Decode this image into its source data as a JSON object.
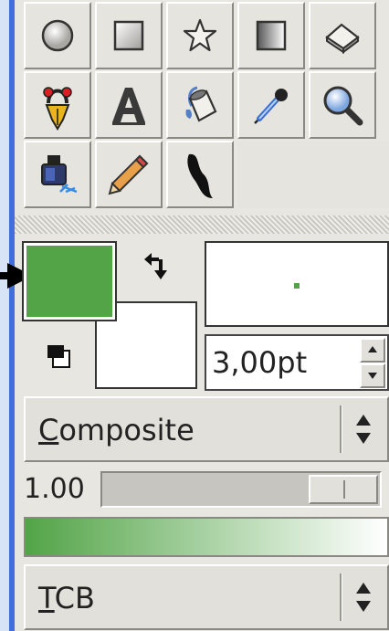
{
  "colors": {
    "foreground": "#52a447",
    "background": "#ffffff",
    "gradient_start": "#52a447",
    "gradient_end": "#ffffff",
    "panel_accent": "#3f6fd8"
  },
  "tools": [
    {
      "name": "ellipse-tool",
      "icon": "circle-icon"
    },
    {
      "name": "rectangle-tool",
      "icon": "square-icon"
    },
    {
      "name": "star-tool",
      "icon": "star-icon"
    },
    {
      "name": "gradient-tool",
      "icon": "gradient-icon"
    },
    {
      "name": "eraser-tool",
      "icon": "eraser-icon"
    },
    {
      "name": "bezier-tool",
      "icon": "pen-nib-icon"
    },
    {
      "name": "text-tool",
      "icon": "text-A-icon"
    },
    {
      "name": "bucket-fill-tool",
      "icon": "paint-bucket-icon"
    },
    {
      "name": "color-picker-tool",
      "icon": "eyedropper-icon"
    },
    {
      "name": "zoom-tool",
      "icon": "magnifier-icon"
    },
    {
      "name": "ink-tool",
      "icon": "ink-bottle-icon"
    },
    {
      "name": "pencil-tool",
      "icon": "pencil-icon"
    },
    {
      "name": "calligraphy-tool",
      "icon": "calligraphy-brush-icon"
    }
  ],
  "line_width": "3,00pt",
  "composite_mode": {
    "underlined_char": "C",
    "rest": "omposite"
  },
  "opacity": {
    "value_label": "1.00",
    "level": 1.0
  },
  "arrow_style": {
    "underlined_char": "T",
    "rest": "CB"
  }
}
